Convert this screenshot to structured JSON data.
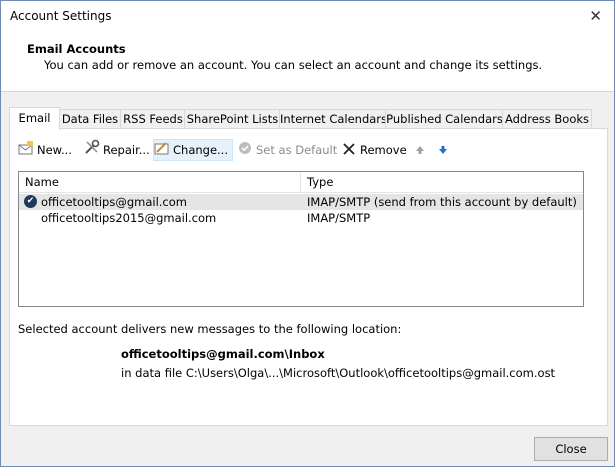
{
  "window": {
    "title": "Account Settings",
    "close_glyph": "✕"
  },
  "header": {
    "title": "Email Accounts",
    "description": "You can add or remove an account. You can select an account and change its settings."
  },
  "tabs": [
    {
      "label": "Email"
    },
    {
      "label": "Data Files"
    },
    {
      "label": "RSS Feeds"
    },
    {
      "label": "SharePoint Lists"
    },
    {
      "label": "Internet Calendars"
    },
    {
      "label": "Published Calendars"
    },
    {
      "label": "Address Books"
    }
  ],
  "toolbar": {
    "new_label": "New...",
    "repair_label": "Repair...",
    "change_label": "Change...",
    "set_default_label": "Set as Default",
    "remove_label": "Remove",
    "icons": {
      "new": "new-mail-icon",
      "repair": "tools-icon",
      "change": "change-icon",
      "set_default": "checkmark-circle-icon",
      "remove": "x-icon",
      "up": "arrow-up-icon",
      "down": "arrow-down-icon"
    }
  },
  "accounts": {
    "columns": {
      "name": "Name",
      "type": "Type"
    },
    "rows": [
      {
        "name": "officetooltips@gmail.com",
        "type": "IMAP/SMTP (send from this account by default)",
        "default": true
      },
      {
        "name": "officetooltips2015@gmail.com",
        "type": "IMAP/SMTP",
        "default": false
      }
    ]
  },
  "location": {
    "intro": "Selected account delivers new messages to the following location:",
    "path": "officetooltips@gmail.com\\Inbox",
    "file": "in data file C:\\Users\\Olga\\...\\Microsoft\\Outlook\\officetooltips@gmail.com.ost"
  },
  "footer": {
    "close_label": "Close"
  },
  "colors": {
    "accent": "#1e73c8",
    "selected_row": "#e5e5e5",
    "hover": "#e5f1fb"
  }
}
